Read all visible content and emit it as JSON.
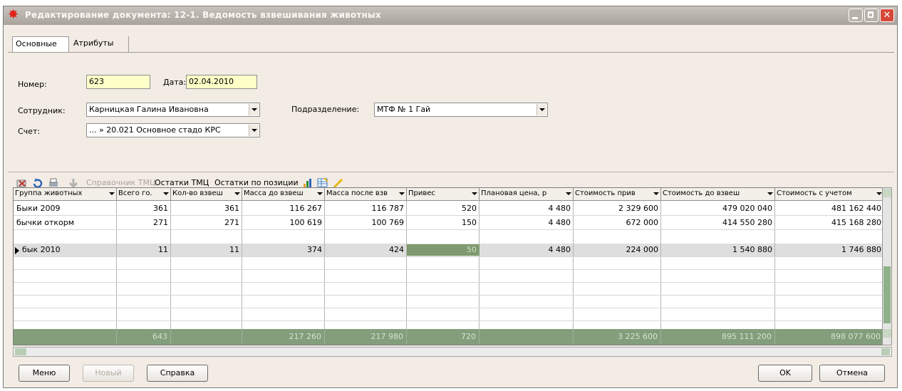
{
  "window": {
    "title": "Редактирование документа: 12-1. Ведомость взвешивания животных",
    "title_icon": "red-star-icon"
  },
  "tabs": [
    "Основные",
    "Атрибуты"
  ],
  "form": {
    "number_label": "Номер:",
    "number_value": "623",
    "date_label": "Дата:",
    "date_value": "02.04.2010",
    "employee_label": "Сотрудник:",
    "employee_value": "Карницкая Галина Ивановна",
    "account_label": "Счет:",
    "account_value": "... » 20.021 Основное стадо КРС",
    "division_label": "Подразделение:",
    "division_value": "МТФ № 1 Гай"
  },
  "toolbar": {
    "ref_label": "Справочник ТМЦ",
    "stock_label": "Остатки ТМЦ",
    "stock_pos_label": "Остатки по позиции"
  },
  "grid": {
    "headers": [
      "Группа животных",
      "Всего го.",
      "Кол-во взвеш",
      "Масса до взвеш",
      "Масса после взв",
      "Привес",
      "Плановая цена, р",
      "Стоимость прив",
      "Стоимость до взвеш",
      "Стоимость с учетом"
    ],
    "rows": [
      [
        "Быки 2009",
        "361",
        "361",
        "116 267",
        "116 787",
        "520",
        "4 480",
        "2 329 600",
        "479 020 040",
        "481 162 440"
      ],
      [
        "бычки откорм",
        "271",
        "271",
        "100 619",
        "100 769",
        "150",
        "4 480",
        "672 000",
        "414 550 280",
        "415 168 280"
      ],
      [
        "бык 2010",
        "11",
        "11",
        "374",
        "424",
        "50",
        "4 480",
        "224 000",
        "1 540 880",
        "1 746 880"
      ]
    ],
    "totals": [
      "",
      "643",
      "",
      "217 260",
      "217 980",
      "720",
      "",
      "3 225 600",
      "895 111 200",
      "898 077 600"
    ]
  },
  "buttons": {
    "menu": "Меню",
    "new": "Новый",
    "help": "Справка",
    "ok": "OK",
    "cancel": "Отмена"
  },
  "colors": {
    "window_bg": "#f2ece4",
    "title_bg": "#aaa39d",
    "highlight_input": "#ffffc8",
    "totals_bg": "#839e7b"
  }
}
